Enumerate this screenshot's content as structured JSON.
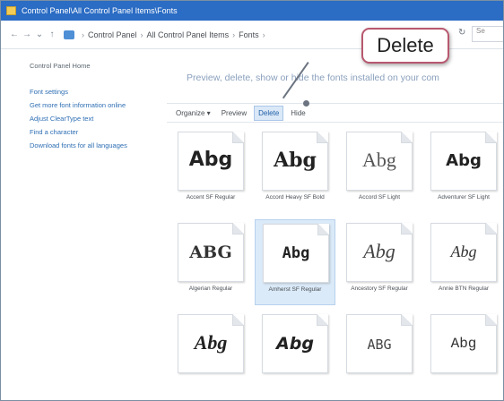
{
  "window": {
    "title": "Control Panel\\All Control Panel Items\\Fonts"
  },
  "address": {
    "back": "←",
    "forward": "→",
    "down": "⌄",
    "up": "↑",
    "crumbs": [
      "Control Panel",
      "All Control Panel Items",
      "Fonts"
    ],
    "separator": "›",
    "refresh": "↻",
    "search_placeholder": "Se"
  },
  "sidebar": {
    "home": "Control Panel Home",
    "items": [
      "Font settings",
      "Get more font information online",
      "Adjust ClearType text",
      "Find a character",
      "Download fonts for all languages"
    ]
  },
  "main": {
    "description": "Preview, delete, show or hide the fonts installed on your com",
    "toolbar": {
      "organize": "Organize ▾",
      "preview": "Preview",
      "delete": "Delete",
      "hide": "Hide"
    }
  },
  "fonts": [
    {
      "name": "Accent SF Regular",
      "sample": "Abg"
    },
    {
      "name": "Accord Heavy SF Bold",
      "sample": "Abg"
    },
    {
      "name": "Accord SF Light",
      "sample": "Abg"
    },
    {
      "name": "Adventurer SF Light",
      "sample": "Abg"
    },
    {
      "name": "Algerian Regular",
      "sample": "ABG"
    },
    {
      "name": "Amherst SF Regular",
      "sample": "Abg"
    },
    {
      "name": "Ancestory SF Regular",
      "sample": "Abg"
    },
    {
      "name": "Annie BTN Regular",
      "sample": "Abg"
    },
    {
      "name": "",
      "sample": "Abg"
    },
    {
      "name": "",
      "sample": "Abg"
    },
    {
      "name": "",
      "sample": "ABG"
    },
    {
      "name": "",
      "sample": "Abg"
    }
  ],
  "callout": {
    "label": "Delete",
    "border_color": "#b8586f"
  },
  "colors": {
    "titlebar": "#2b6cc4",
    "link": "#2f6fb4",
    "selected_tile": "#dbeaf8"
  }
}
